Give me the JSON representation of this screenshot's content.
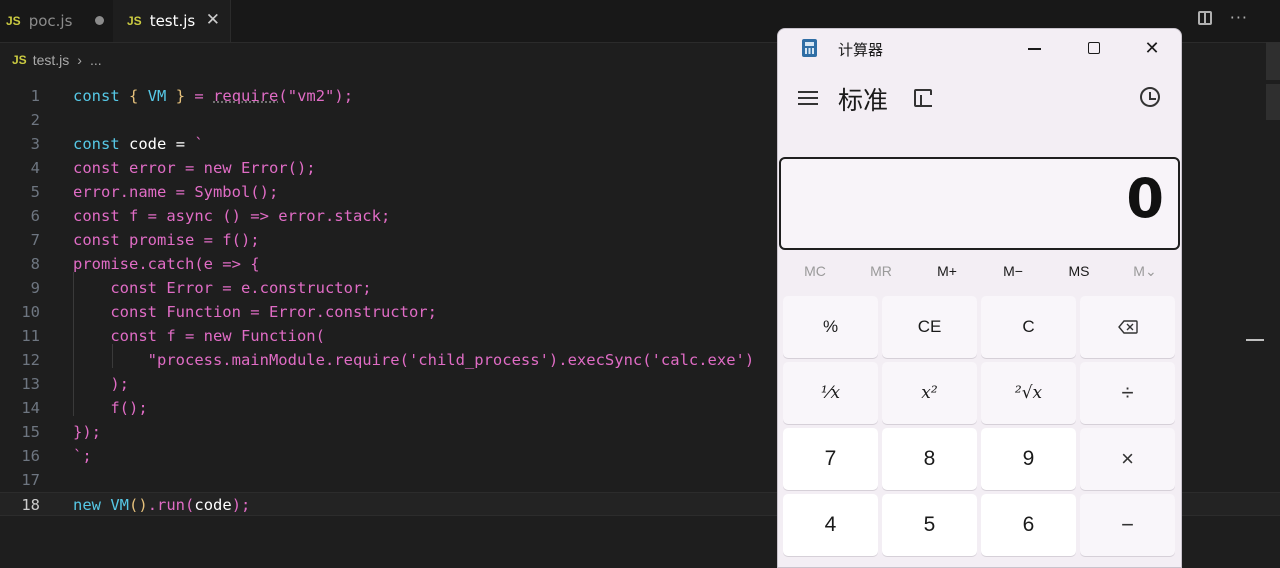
{
  "tabs": [
    {
      "icon": "JS",
      "label": "poc.js"
    },
    {
      "icon": "JS",
      "label": "test.js"
    }
  ],
  "breadcrumb": {
    "icon": "JS",
    "file": "test.js",
    "sep": "›",
    "more": "..."
  },
  "editor": {
    "line_numbers": [
      "1",
      "2",
      "3",
      "4",
      "5",
      "6",
      "7",
      "8",
      "9",
      "10",
      "11",
      "12",
      "13",
      "14",
      "15",
      "16",
      "17",
      "18"
    ],
    "active_line": 18
  },
  "calculator": {
    "window_title": "计算器",
    "mode": "标准",
    "display": "0",
    "memory": [
      "MC",
      "MR",
      "M+",
      "M−",
      "MS",
      "M⌄"
    ],
    "keys": {
      "percent": "%",
      "ce": "CE",
      "c": "C",
      "reciprocal": "¹⁄x",
      "square": "x²",
      "sqrt": "²√x",
      "divide": "÷",
      "seven": "7",
      "eight": "8",
      "nine": "9",
      "multiply": "×",
      "four": "4",
      "five": "5",
      "six": "6",
      "minus": "−"
    }
  }
}
